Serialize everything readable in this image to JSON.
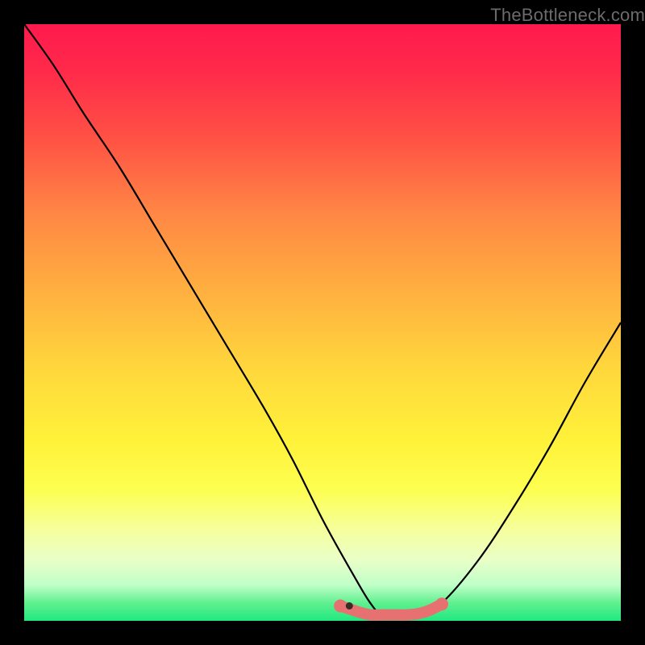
{
  "watermark": "TheBottleneck.com",
  "chart_data": {
    "type": "line",
    "title": "",
    "xlabel": "",
    "ylabel": "",
    "curve": {
      "name": "bottleneck-curve",
      "x": [
        0.0,
        0.05,
        0.1,
        0.16,
        0.22,
        0.28,
        0.34,
        0.4,
        0.45,
        0.5,
        0.55,
        0.58,
        0.6,
        0.63,
        0.66,
        0.7,
        0.76,
        0.82,
        0.88,
        0.94,
        1.0
      ],
      "y": [
        1.0,
        0.93,
        0.85,
        0.76,
        0.66,
        0.56,
        0.46,
        0.36,
        0.27,
        0.17,
        0.08,
        0.03,
        0.01,
        0.01,
        0.01,
        0.03,
        0.1,
        0.19,
        0.29,
        0.4,
        0.5
      ]
    },
    "valley_markers": {
      "color": "#e77070",
      "x": [
        0.53,
        0.56,
        0.58,
        0.6,
        0.62,
        0.64,
        0.66,
        0.68,
        0.7
      ],
      "y": [
        0.025,
        0.015,
        0.01,
        0.01,
        0.01,
        0.01,
        0.012,
        0.018,
        0.028
      ]
    },
    "marker_dark": {
      "x": 0.545,
      "y": 0.025
    }
  }
}
